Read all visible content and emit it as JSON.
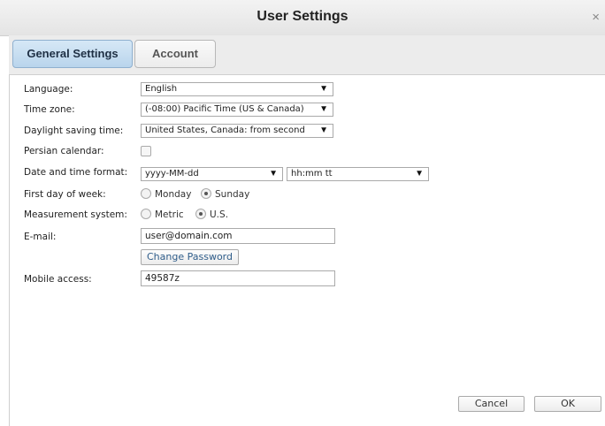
{
  "window": {
    "title": "User Settings",
    "close_glyph": "×"
  },
  "tabs": [
    {
      "label": "General Settings",
      "active": true
    },
    {
      "label": "Account",
      "active": false
    }
  ],
  "form": {
    "language": {
      "label": "Language:",
      "value": "English"
    },
    "time_zone": {
      "label": "Time zone:",
      "value": "(-08:00) Pacific Time (US & Canada)"
    },
    "dst": {
      "label": "Daylight saving time:",
      "value": "United States, Canada: from second"
    },
    "persian_calendar": {
      "label": "Persian calendar:",
      "checked": false
    },
    "datetime_format": {
      "label": "Date and time format:",
      "date_value": "yyyy-MM-dd",
      "time_value": "hh:mm tt"
    },
    "first_day": {
      "label": "First day of week:",
      "options": [
        "Monday",
        "Sunday"
      ],
      "selected": "Sunday"
    },
    "measurement": {
      "label": "Measurement system:",
      "options": [
        "Metric",
        "U.S."
      ],
      "selected": "U.S."
    },
    "email": {
      "label": "E-mail:",
      "value": "user@domain.com"
    },
    "change_password": {
      "label": "Change Password"
    },
    "mobile_access": {
      "label": "Mobile access:",
      "value": "49587z"
    }
  },
  "footer": {
    "cancel_label": "Cancel",
    "ok_label": "OK"
  },
  "icons": {
    "dropdown_arrow": "chevron-down-icon",
    "close": "close-icon"
  },
  "colors": {
    "active_tab_bg": "#c7ddf1",
    "link_text": "#2f5d8a"
  }
}
